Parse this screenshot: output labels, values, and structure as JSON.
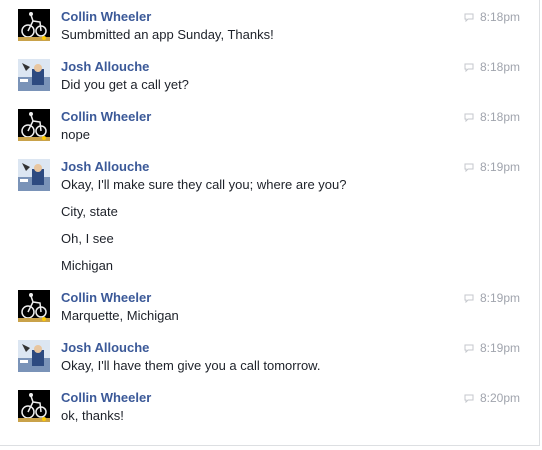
{
  "messages": [
    {
      "sender": "Collin Wheeler",
      "avatar": "collin-avatar",
      "time": "8:18pm",
      "lines": [
        "Sumbmitted an app Sunday, Thanks!"
      ]
    },
    {
      "sender": "Josh Allouche",
      "avatar": "josh-avatar",
      "time": "8:18pm",
      "lines": [
        "Did you get a call yet?"
      ]
    },
    {
      "sender": "Collin Wheeler",
      "avatar": "collin-avatar",
      "time": "8:18pm",
      "lines": [
        "nope"
      ]
    },
    {
      "sender": "Josh Allouche",
      "avatar": "josh-avatar",
      "time": "8:19pm",
      "lines": [
        "Okay, I'll make sure they call you; where are you?",
        "City, state",
        "Oh, I see",
        "Michigan"
      ]
    },
    {
      "sender": "Collin Wheeler",
      "avatar": "collin-avatar",
      "time": "8:19pm",
      "lines": [
        "Marquette, Michigan"
      ]
    },
    {
      "sender": "Josh Allouche",
      "avatar": "josh-avatar",
      "time": "8:19pm",
      "lines": [
        "Okay, I'll have them give you a call tomorrow."
      ]
    },
    {
      "sender": "Collin Wheeler",
      "avatar": "collin-avatar",
      "time": "8:20pm",
      "lines": [
        "ok, thanks!"
      ]
    }
  ],
  "colors": {
    "sender": "#3b5998",
    "time": "#a0a4ad",
    "text": "#1d2129"
  }
}
